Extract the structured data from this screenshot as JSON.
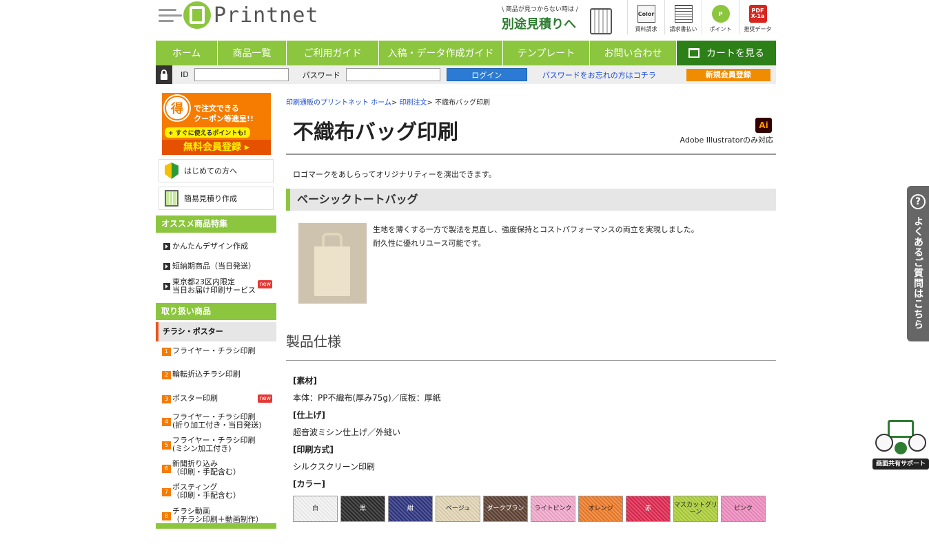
{
  "header": {
    "logo_text": "Printnet",
    "estimate_small": "\\ 商品が見つからない時は /",
    "estimate_big": "別途見積りへ",
    "icons": [
      {
        "label": "資料請求",
        "glyph": "Color",
        "icon": "brochure-icon"
      },
      {
        "label": "請求書払い",
        "glyph": "",
        "icon": "invoice-icon"
      },
      {
        "label": "ポイント",
        "glyph": "P",
        "icon": "point-icon"
      },
      {
        "label": "推奨データ",
        "glyph": "PDF X-1a",
        "icon": "pdf-icon"
      }
    ]
  },
  "nav": {
    "items": [
      "ホーム",
      "商品一覧",
      "ご利用ガイド",
      "入稿・データ作成ガイド",
      "テンプレート",
      "お問い合わせ"
    ],
    "cart": "カートを見る"
  },
  "login": {
    "id_label": "ID",
    "password_label": "パスワード",
    "login_button": "ログイン",
    "forgot": "パスワードをお忘れの方はコチラ",
    "register": "新規会員登録"
  },
  "sidebar": {
    "banner": {
      "coin": "得",
      "line1": "で注文できる",
      "line2": "クーポン等進呈!!",
      "line3": "+ すぐに使えるポイントも!",
      "line4": "無料会員登録 ▸"
    },
    "links": [
      "はじめての方へ",
      "簡易見積り作成"
    ],
    "recommend_head": "オススメ商品特集",
    "recommend": [
      "かんたんデザイン作成",
      "短納期商品（当日発送）",
      "東京都23区内限定",
      "当日お届け印刷サービス"
    ],
    "new_tag": "new",
    "products_head": "取り扱い商品",
    "category": "チラシ・ポスター",
    "items": [
      {
        "num": "1",
        "line1": "フライヤー・チラシ印刷",
        "line2": ""
      },
      {
        "num": "2",
        "line1": "輪転折込チラシ印刷",
        "line2": ""
      },
      {
        "num": "3",
        "line1": "ポスター印刷",
        "line2": ""
      },
      {
        "num": "4",
        "line1": "フライヤー・チラシ印刷",
        "line2": "(折り加工付き・当日発送)"
      },
      {
        "num": "5",
        "line1": "フライヤー・チラシ印刷",
        "line2": "(ミシン加工付き)"
      },
      {
        "num": "6",
        "line1": "新聞折り込み",
        "line2": "（印刷・手配含む）"
      },
      {
        "num": "7",
        "line1": "ポスティング",
        "line2": "（印刷・手配含む）"
      },
      {
        "num": "8",
        "line1": "チラシ動画",
        "line2": "（チラシ印刷＋動画制作）"
      }
    ]
  },
  "main": {
    "breadcrumb": [
      "印刷通販のプリントネット ホーム",
      "印刷注文",
      "不織布バッグ印刷"
    ],
    "title": "不織布バッグ印刷",
    "ai_badge": "Ai",
    "ai_note": "Adobe Illustratorのみ対応",
    "intro": "ロゴマークをあしらってオリジナリティーを演出できます。",
    "section": "ベーシックトートバッグ",
    "desc1": "生地を薄くする一方で製法を見直し、強度保持とコストパフォーマンスの両立を実現しました。",
    "desc2": "耐久性に優れリユース可能です。",
    "spec_title": "製品仕様",
    "spec": [
      {
        "label": "[素材]",
        "value": "本体：PP不織布(厚み75g)／底板：厚紙"
      },
      {
        "label": "[仕上げ]",
        "value": "超音波ミシン仕上げ／外縫い"
      },
      {
        "label": "[印刷方式]",
        "value": "シルクスクリーン印刷"
      }
    ],
    "color_label": "[カラー]",
    "colors": [
      {
        "name": "白",
        "hex": "#f4f4f4",
        "text": "#222"
      },
      {
        "name": "黒",
        "hex": "#2a2a2a",
        "text": "#fff"
      },
      {
        "name": "紺",
        "hex": "#2f3580",
        "text": "#fff"
      },
      {
        "name": "ベージュ",
        "hex": "#e3d6b6",
        "text": "#222"
      },
      {
        "name": "ダークブラン",
        "hex": "#5e4234",
        "text": "#fff"
      },
      {
        "name": "ライトピンク",
        "hex": "#f3a9cc",
        "text": "#222"
      },
      {
        "name": "オレンジ",
        "hex": "#ef7d2b",
        "text": "#222"
      },
      {
        "name": "赤",
        "hex": "#e02850",
        "text": "#fff"
      },
      {
        "name": "マスカットグリーン",
        "hex": "#aed03a",
        "text": "#222"
      },
      {
        "name": "ピンク",
        "hex": "#f08cc0",
        "text": "#222"
      }
    ]
  },
  "float": {
    "faq_q": "?",
    "faq": "よくあるご質問はこちら",
    "screenshare": "画面共有サポート"
  }
}
